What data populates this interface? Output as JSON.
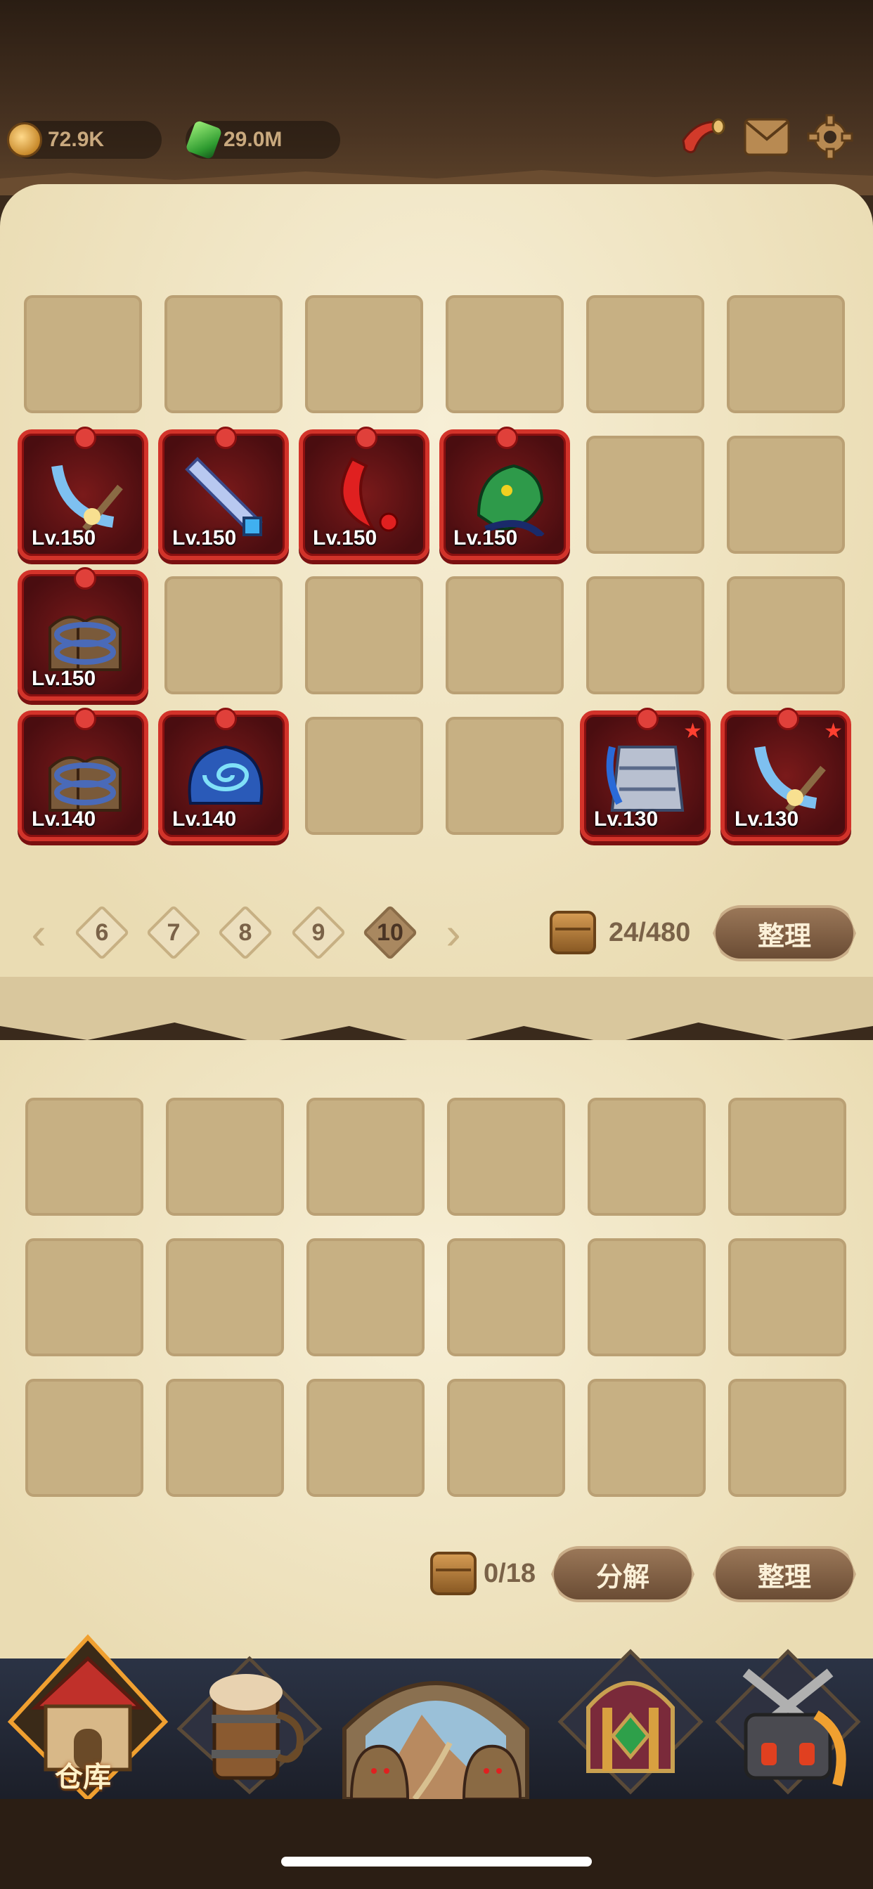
{
  "currencies": [
    {
      "name": "gold",
      "icon": "gold-coin-icon",
      "value": "72.9K"
    },
    {
      "name": "gems",
      "icon": "green-gem-icon",
      "value": "29.0M"
    }
  ],
  "top_icons": [
    "horn-icon",
    "mail-icon",
    "settings-gear-icon"
  ],
  "inventory": {
    "items": [
      {
        "level": "Lv.150",
        "art": "curved-blade-icon"
      },
      {
        "level": "Lv.150",
        "art": "crystal-sword-icon"
      },
      {
        "level": "Lv.150",
        "art": "red-scimitar-icon"
      },
      {
        "level": "Lv.150",
        "art": "dragon-helm-icon"
      },
      {
        "level": "Lv.150",
        "art": "chained-gauntlets-icon"
      },
      {
        "level": "Lv.140",
        "art": "chained-gauntlets-icon"
      },
      {
        "level": "Lv.140",
        "art": "swirl-armor-icon"
      },
      {
        "level": "Lv.130",
        "art": "plate-armor-icon"
      },
      {
        "level": "Lv.130",
        "art": "curved-blade-icon"
      }
    ],
    "pages": [
      "6",
      "7",
      "8",
      "9",
      "10"
    ],
    "active_page": "10",
    "count": "24/480",
    "sort_label": "整理"
  },
  "salvage": {
    "count": "0/18",
    "decompose_label": "分解",
    "sort_label": "整理"
  },
  "nav": {
    "items": [
      "warehouse-house-icon",
      "tavern-mug-icon",
      "adventure-portal-icon",
      "artifact-shrine-icon",
      "forge-cauldron-icon"
    ],
    "warehouse_label": "仓库"
  },
  "colors": {
    "item_frame": "#d2332a",
    "parchment": "#f1e6c6",
    "slot": "#c7b083"
  }
}
